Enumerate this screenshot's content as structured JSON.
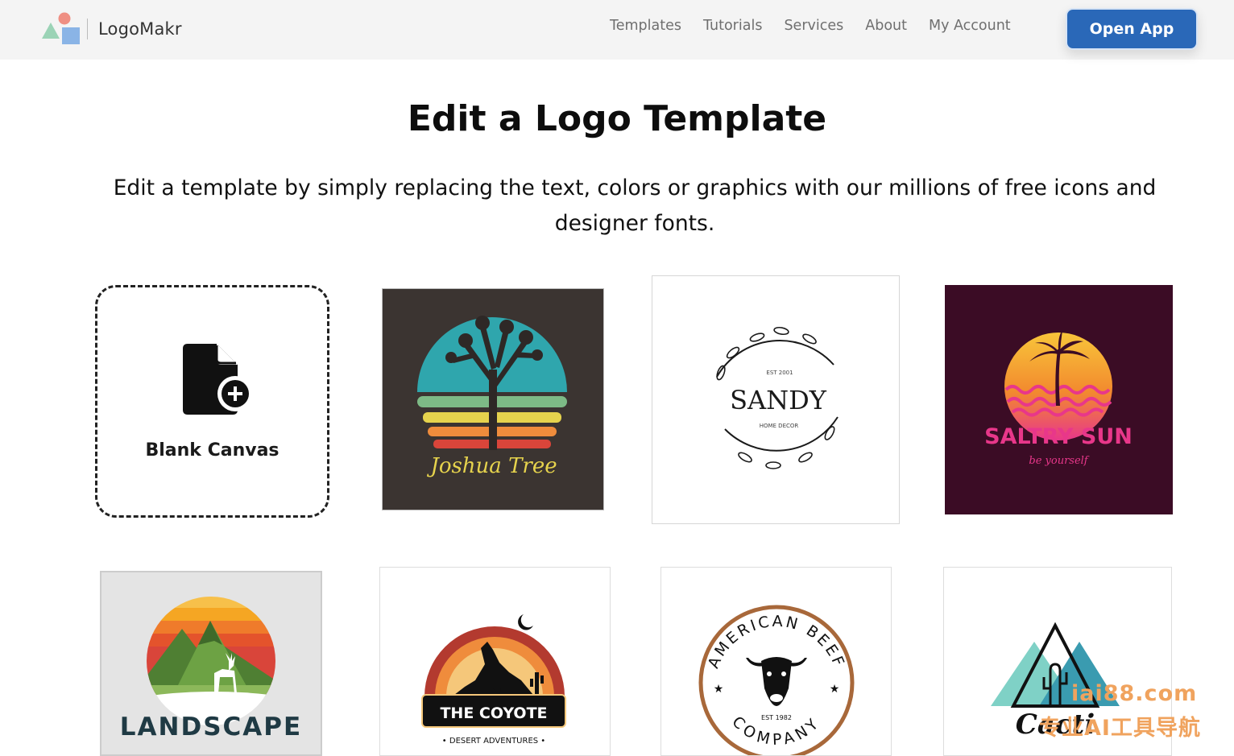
{
  "app": {
    "name": "LogoMakr"
  },
  "nav": {
    "items": [
      "Templates",
      "Tutorials",
      "Services",
      "About",
      "My Account"
    ],
    "cta": "Open App"
  },
  "hero": {
    "title": "Edit a Logo Template",
    "subtitle": "Edit a template by simply replacing the text, colors or graphics with our millions of free icons and designer fonts."
  },
  "blank_canvas": {
    "label": "Blank Canvas",
    "icon": "add-file-icon"
  },
  "templates": [
    {
      "text": "Joshua Tree",
      "colors": [
        "#3b3431",
        "#2fa6ad",
        "#e6d34d",
        "#ef8c3c",
        "#d9453a"
      ]
    },
    {
      "text": "SANDY",
      "tagline_top": "EST 2001",
      "tagline_bottom": "HOME DECOR",
      "colors": [
        "#ffffff",
        "#1a1a1a"
      ]
    },
    {
      "text": "SALTRY SUN",
      "tagline": "be yourself",
      "colors": [
        "#3b0c25",
        "#f6b43a",
        "#e8378a"
      ]
    },
    {
      "text": "LANDSCAPE",
      "colors": [
        "#e4e4e4",
        "#f5a623",
        "#d9453a",
        "#5d8f3a",
        "#1f3a44"
      ]
    },
    {
      "text": "THE COYOTE",
      "tagline": "• DESERT ADVENTURES •",
      "colors": [
        "#ffffff",
        "#c0392b",
        "#f39c12",
        "#111111"
      ]
    },
    {
      "text_top": "AMERICAN BEEF",
      "text_bottom": "COMPANY",
      "tagline": "EST 1982",
      "colors": [
        "#ffffff",
        "#a8683a",
        "#111111"
      ]
    },
    {
      "text": "Cacti",
      "colors": [
        "#ffffff",
        "#5fc8c0",
        "#3a9bb0",
        "#111111"
      ]
    }
  ],
  "watermark": {
    "domain": "iai88.com",
    "slogan": "专业AI工具导航"
  }
}
